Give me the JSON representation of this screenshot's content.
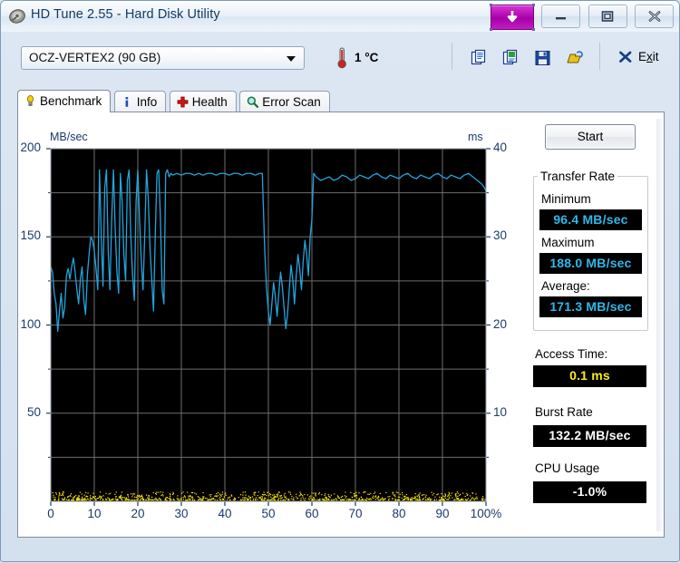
{
  "window": {
    "title": "HD Tune 2.55 - Hard Disk Utility",
    "icon": "hard-disk-icon",
    "controls": {
      "download": "download-arrow-icon",
      "minimize": "minimize-icon",
      "maximize": "maximize-icon",
      "close": "close-icon"
    }
  },
  "toolbar": {
    "drive": "OCZ-VERTEX2 (90 GB)",
    "temperature": "1 °C",
    "thermometer_icon": "thermometer-icon",
    "buttons": [
      {
        "name": "copy-text-icon",
        "label": "Copy text"
      },
      {
        "name": "copy-image-icon",
        "label": "Copy image"
      },
      {
        "name": "save-icon",
        "label": "Save"
      },
      {
        "name": "folder-icon",
        "label": "Open"
      }
    ],
    "exit_label_pre": "E",
    "exit_label_accel": "x",
    "exit_label_post": "it",
    "exit_icon": "close-x-icon"
  },
  "tabs": [
    {
      "label": "Benchmark",
      "icon": "lightbulb-icon",
      "active": true
    },
    {
      "label": "Info",
      "icon": "info-icon",
      "active": false
    },
    {
      "label": "Health",
      "icon": "red-cross-icon",
      "active": false
    },
    {
      "label": "Error Scan",
      "icon": "magnifier-icon",
      "active": false
    }
  ],
  "actions": {
    "start_label": "Start"
  },
  "results": {
    "transfer_rate_group": "Transfer Rate",
    "minimum_label": "Minimum",
    "minimum_value": "96.4 MB/sec",
    "maximum_label": "Maximum",
    "maximum_value": "188.0 MB/sec",
    "average_label": "Average:",
    "average_value": "171.3 MB/sec",
    "access_time_label": "Access Time:",
    "access_time_value": "0.1 ms",
    "burst_rate_label": "Burst Rate",
    "burst_rate_value": "132.2 MB/sec",
    "cpu_usage_label": "CPU Usage",
    "cpu_usage_value": "-1.0%"
  },
  "colors": {
    "transfer_line": "#22a5dd",
    "access_dots": "#ffe800",
    "lcd_background": "#000000",
    "lcd_cyan": "#2fb8e8",
    "lcd_yellow": "#ffec1f",
    "grid": "#6e6e6e",
    "plot_background": "#000000",
    "axis_text": "#1b3a6b"
  },
  "chart_data": {
    "type": "line",
    "title": "",
    "xlabel": "",
    "ylabel": "MB/sec",
    "y2label": "ms",
    "xlim": [
      0,
      100
    ],
    "ylim": [
      0,
      200
    ],
    "y2lim": [
      0,
      40
    ],
    "grid": true,
    "legend": null,
    "x_ticks": [
      0,
      10,
      20,
      30,
      40,
      50,
      60,
      70,
      80,
      90,
      100
    ],
    "x_tick_labels": [
      "0",
      "10",
      "20",
      "30",
      "40",
      "50",
      "60",
      "70",
      "80",
      "90",
      "100%"
    ],
    "y_ticks": [
      50,
      100,
      150,
      200
    ],
    "y_tick_labels": [
      "50",
      "100",
      "150",
      "200"
    ],
    "y_minor_ticks": [
      25,
      75,
      125,
      175
    ],
    "y2_ticks": [
      10,
      20,
      30,
      40
    ],
    "y2_tick_labels": [
      "10",
      "20",
      "30",
      "40"
    ],
    "series": [
      {
        "name": "Transfer Rate",
        "unit": "MB/sec",
        "color": "#22a5dd",
        "axis": "left",
        "x": [
          0.0,
          0.4,
          0.8,
          1.2,
          1.6,
          2.0,
          2.4,
          2.8,
          3.2,
          3.6,
          4.0,
          4.4,
          4.8,
          5.2,
          5.6,
          6.0,
          6.4,
          6.8,
          7.2,
          7.6,
          8.0,
          8.4,
          8.8,
          9.2,
          9.6,
          10.0,
          10.4,
          10.8,
          11.2,
          11.6,
          12.0,
          12.4,
          12.8,
          13.2,
          13.6,
          14.0,
          14.4,
          14.8,
          15.2,
          15.6,
          16.0,
          16.4,
          16.8,
          17.2,
          17.6,
          18.0,
          18.4,
          18.8,
          19.2,
          19.6,
          20.0,
          20.4,
          20.8,
          21.2,
          21.6,
          22.0,
          22.4,
          22.8,
          23.2,
          23.6,
          24.0,
          24.4,
          24.8,
          25.2,
          25.6,
          26.0,
          26.4,
          26.8,
          27.2,
          27.6,
          28.0,
          29.0,
          30.0,
          31.0,
          32.0,
          33.0,
          34.0,
          35.0,
          36.0,
          37.0,
          38.0,
          39.0,
          40.0,
          41.0,
          42.0,
          43.0,
          44.0,
          45.0,
          46.0,
          47.0,
          48.0,
          48.6,
          49.2,
          49.6,
          50.0,
          50.4,
          50.8,
          51.2,
          51.6,
          52.0,
          52.4,
          52.8,
          53.2,
          53.6,
          54.0,
          54.4,
          54.8,
          55.2,
          55.6,
          56.0,
          56.4,
          56.8,
          57.2,
          57.6,
          58.0,
          58.4,
          58.8,
          59.2,
          59.6,
          60.0,
          60.4,
          61.0,
          62.0,
          63.0,
          64.0,
          65.0,
          66.0,
          67.0,
          68.0,
          69.0,
          70.0,
          71.0,
          72.0,
          73.0,
          74.0,
          75.0,
          76.0,
          77.0,
          78.0,
          79.0,
          80.0,
          81.0,
          82.0,
          83.0,
          84.0,
          85.0,
          86.0,
          87.0,
          88.0,
          89.0,
          90.0,
          91.0,
          92.0,
          93.0,
          94.0,
          95.0,
          96.0,
          97.0,
          98.0,
          99.0,
          99.6,
          100.0
        ],
        "y": [
          133,
          130,
          118,
          112,
          96.4,
          108,
          118,
          104,
          110,
          128,
          132,
          126,
          133,
          138,
          130,
          120,
          112,
          126,
          133,
          114,
          106,
          128,
          140,
          150,
          148,
          142,
          132,
          120,
          188,
          150,
          122,
          178,
          188,
          142,
          120,
          160,
          188,
          155,
          130,
          118,
          186,
          170,
          140,
          125,
          182,
          188,
          150,
          128,
          114,
          170,
          188,
          160,
          136,
          120,
          152,
          188,
          172,
          144,
          126,
          108,
          150,
          186,
          188,
          160,
          120,
          112,
          186,
          188,
          184,
          186,
          185,
          186,
          185,
          186,
          186,
          185,
          186,
          185,
          186,
          186,
          185,
          186,
          186,
          185,
          186,
          186,
          185,
          186,
          186,
          185,
          186,
          186,
          140,
          120,
          108,
          100,
          112,
          124,
          116,
          105,
          118,
          130,
          122,
          110,
          98,
          106,
          120,
          134,
          126,
          112,
          128,
          140,
          132,
          120,
          136,
          148,
          140,
          128,
          150,
          160,
          186,
          184,
          182,
          183,
          184,
          182,
          183,
          185,
          184,
          182,
          183,
          185,
          184,
          183,
          185,
          186,
          184,
          183,
          185,
          184,
          183,
          185,
          186,
          184,
          183,
          185,
          184,
          183,
          185,
          186,
          184,
          183,
          185,
          184,
          183,
          185,
          186,
          184,
          182,
          180,
          178,
          176
        ]
      },
      {
        "name": "Access Time",
        "unit": "ms",
        "color": "#ffe800",
        "axis": "right",
        "marker": "dot",
        "approx_value": 0.1,
        "note": "dense scatter of dots along the bottom of the plot, all near 0.1 ms"
      }
    ]
  }
}
